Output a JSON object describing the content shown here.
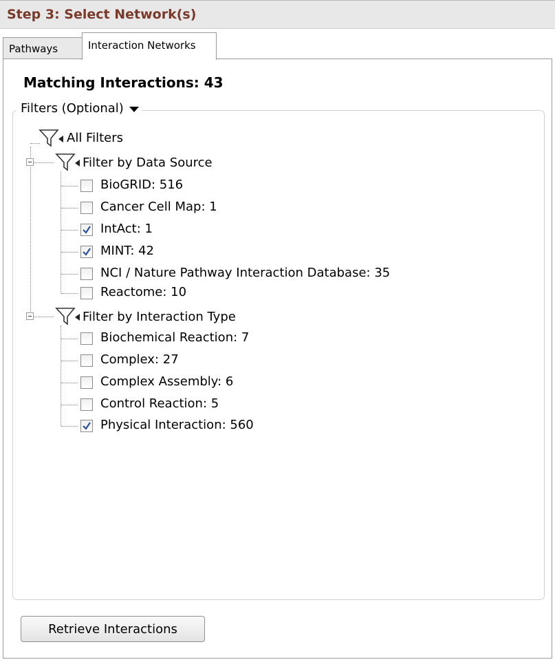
{
  "header": {
    "title": "Step 3:  Select Network(s)"
  },
  "tabs": [
    {
      "label": "Pathways",
      "active": false
    },
    {
      "label": "Interaction Networks",
      "active": true
    }
  ],
  "matching": {
    "label": "Matching Interactions:  43"
  },
  "filters": {
    "legend": "Filters (Optional)",
    "root": {
      "label": "All Filters",
      "icon": "funnel-icon"
    },
    "groups": [
      {
        "label": "Filter by Data Source",
        "expanded": true,
        "items": [
          {
            "label": "BioGRID:  516",
            "checked": false
          },
          {
            "label": "Cancer Cell Map:  1",
            "checked": false
          },
          {
            "label": "IntAct:  1",
            "checked": true
          },
          {
            "label": "MINT:  42",
            "checked": true
          },
          {
            "label": "NCI / Nature Pathway Interaction Database:  35",
            "checked": false
          },
          {
            "label": "Reactome:  10",
            "checked": false
          }
        ]
      },
      {
        "label": "Filter by Interaction Type",
        "expanded": true,
        "items": [
          {
            "label": "Biochemical Reaction:  7",
            "checked": false
          },
          {
            "label": "Complex:  27",
            "checked": false
          },
          {
            "label": "Complex Assembly:  6",
            "checked": false
          },
          {
            "label": "Control Reaction:  5",
            "checked": false
          },
          {
            "label": "Physical Interaction:  560",
            "checked": true
          }
        ]
      }
    ]
  },
  "buttons": {
    "retrieve": "Retrieve Interactions"
  },
  "colors": {
    "header_text": "#7a3a2a",
    "check": "#2b4fa3"
  }
}
